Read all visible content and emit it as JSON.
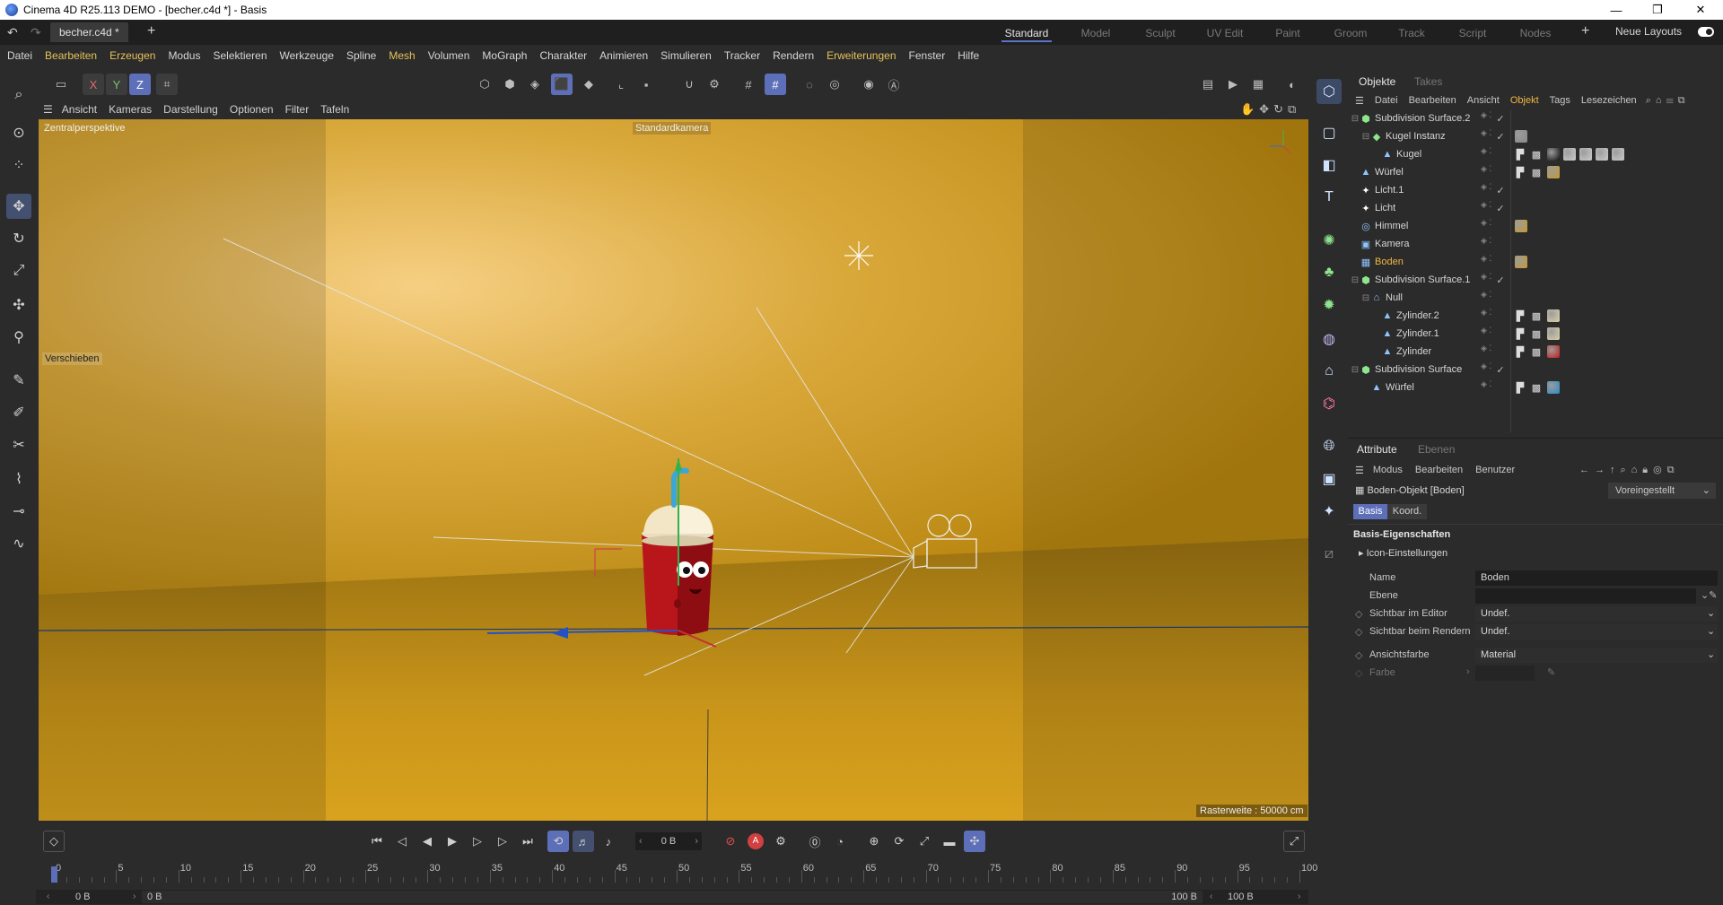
{
  "window": {
    "title": "Cinema 4D R25.113 DEMO - [becher.c4d *] - Basis",
    "minimize": "—",
    "maximize": "❐",
    "close": "✕"
  },
  "tabs": {
    "document": "becher.c4d *",
    "add": "+",
    "layouts": [
      "Standard",
      "Model",
      "Sculpt",
      "UV Edit",
      "Paint",
      "Groom",
      "Track",
      "Script",
      "Nodes"
    ],
    "active_layout": "Standard",
    "new_layouts": "Neue Layouts"
  },
  "menu": {
    "items": [
      "Datei",
      "Bearbeiten",
      "Erzeugen",
      "Modus",
      "Selektieren",
      "Werkzeuge",
      "Spline",
      "Mesh",
      "Volumen",
      "MoGraph",
      "Charakter",
      "Animieren",
      "Simulieren",
      "Tracker",
      "Rendern",
      "Erweiterungen",
      "Fenster",
      "Hilfe"
    ]
  },
  "toolbar": {
    "axis_x": "X",
    "axis_y": "Y",
    "axis_z": "Z"
  },
  "viewport": {
    "menu": [
      "Ansicht",
      "Kameras",
      "Darstellung",
      "Optionen",
      "Filter",
      "Tafeln"
    ],
    "perspective_label": "Zentralperspektive",
    "camera_label": "Standardkamera",
    "tool_label": "Verschieben",
    "grid_label": "Rasterweite : 50000 cm",
    "floor_color": "#c9951a",
    "wall_color": "#d9a83a"
  },
  "objects_panel": {
    "tabs": [
      "Objekte",
      "Takes"
    ],
    "menu": [
      "Datei",
      "Bearbeiten",
      "Ansicht",
      "Objekt",
      "Tags",
      "Lesezeichen"
    ],
    "rows": [
      {
        "label": "Subdivision Surface.2",
        "indent": 0,
        "icon": "subdivision-icon"
      },
      {
        "label": "Kugel Instanz",
        "indent": 1,
        "icon": "instance-icon"
      },
      {
        "label": "Kugel",
        "indent": 2,
        "icon": "polygon-icon"
      },
      {
        "label": "Würfel",
        "indent": 0,
        "icon": "polygon-icon"
      },
      {
        "label": "Licht.1",
        "indent": 0,
        "icon": "light-icon"
      },
      {
        "label": "Licht",
        "indent": 0,
        "icon": "light-icon"
      },
      {
        "label": "Himmel",
        "indent": 0,
        "icon": "sky-icon"
      },
      {
        "label": "Kamera",
        "indent": 0,
        "icon": "camera-icon"
      },
      {
        "label": "Boden",
        "indent": 0,
        "icon": "floor-icon",
        "selected": true
      },
      {
        "label": "Subdivision Surface.1",
        "indent": 0,
        "icon": "subdivision-icon"
      },
      {
        "label": "Null",
        "indent": 1,
        "icon": "null-icon"
      },
      {
        "label": "Zylinder.2",
        "indent": 2,
        "icon": "polygon-icon"
      },
      {
        "label": "Zylinder.1",
        "indent": 2,
        "icon": "polygon-icon"
      },
      {
        "label": "Zylinder",
        "indent": 2,
        "icon": "polygon-icon"
      },
      {
        "label": "Subdivision Surface",
        "indent": 0,
        "icon": "subdivision-icon"
      },
      {
        "label": "Würfel",
        "indent": 1,
        "icon": "polygon-icon"
      }
    ]
  },
  "attributes_panel": {
    "tabs": [
      "Attribute",
      "Ebenen"
    ],
    "menu": [
      "Modus",
      "Bearbeiten",
      "Benutzer"
    ],
    "object_title": "Boden-Objekt [Boden]",
    "preset": "Voreingestellt",
    "subtabs": [
      "Basis",
      "Koord."
    ],
    "section": "Basis-Eigenschaften",
    "subsection": "Icon-Einstellungen",
    "fields": [
      {
        "label": "Name",
        "value": "Boden"
      },
      {
        "label": "Ebene",
        "value": ""
      },
      {
        "label": "Sichtbar im Editor",
        "value": "Undef."
      },
      {
        "label": "Sichtbar beim Rendern",
        "value": "Undef."
      },
      {
        "label": "Ansichtsfarbe",
        "value": "Material"
      },
      {
        "label": "Farbe",
        "value": ""
      }
    ]
  },
  "timeline": {
    "current_frame": "0 B",
    "ruler_ticks": [
      "0",
      "5",
      "10",
      "15",
      "20",
      "25",
      "30",
      "35",
      "40",
      "45",
      "50",
      "55",
      "60",
      "65",
      "70",
      "75",
      "80",
      "85",
      "90",
      "95",
      "100"
    ],
    "start": "0 B",
    "preview_start": "0 B",
    "preview_end": "100 B",
    "end": "100 B"
  },
  "colors": {
    "accent": "#5d6fb8",
    "selection_orange": "#f0b642"
  }
}
